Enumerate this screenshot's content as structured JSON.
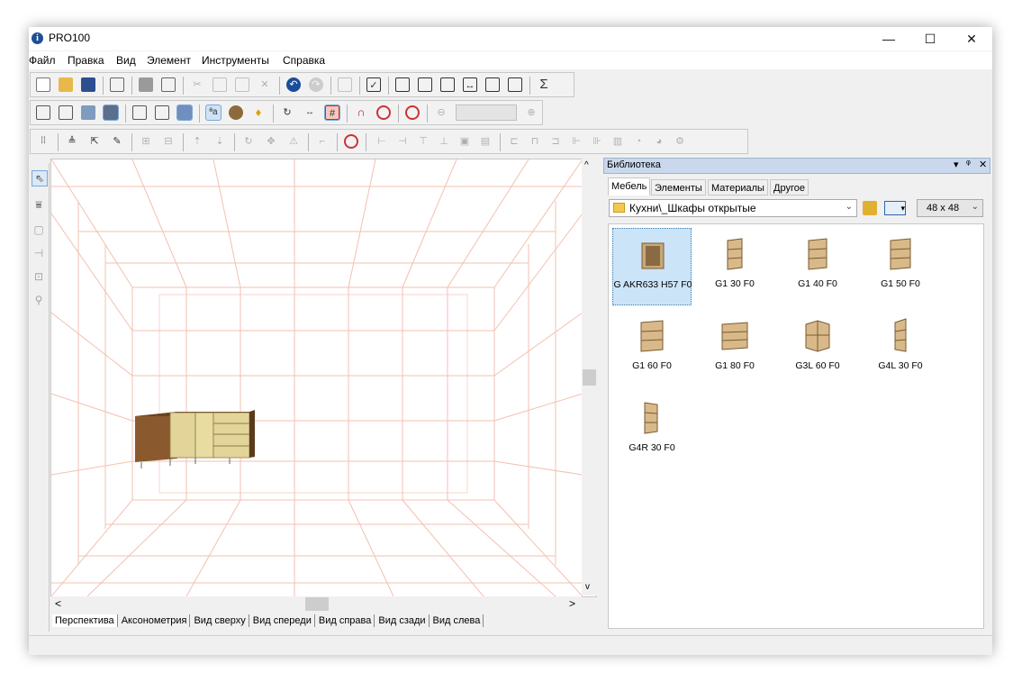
{
  "window": {
    "title": "PRO100",
    "controls": {
      "minimize": "—",
      "maximize": "☐",
      "close": "✕"
    }
  },
  "menu": [
    "Файл",
    "Правка",
    "Вид",
    "Элемент",
    "Инструменты",
    "Справка"
  ],
  "toolbar1": {
    "icons": [
      "new-file-icon",
      "open-icon",
      "save-icon",
      "separator",
      "properties-icon",
      "separator",
      "print-icon",
      "print-preview-icon",
      "separator",
      "cut-icon",
      "copy-icon",
      "paste-icon",
      "delete-icon",
      "separator",
      "undo-icon",
      "redo-icon",
      "separator",
      "clipboard-icon",
      "separator",
      "checklist-icon",
      "separator",
      "report-icon",
      "zoom-page-icon",
      "zoom-fit-icon",
      "width-icon",
      "presentation-icon",
      "money-icon",
      "separator",
      "sum-icon"
    ],
    "sum_glyph": "Σ"
  },
  "toolbar2": {
    "icons": [
      "wireframe-view-icon",
      "outline-view-icon",
      "solid-view-icon",
      "shaded-view-icon",
      "separator",
      "box-outline-icon",
      "box-outline-2-icon",
      "box-solid-icon",
      "separator",
      "text-aa-icon",
      "materials-icon",
      "light-bulb-icon",
      "separator",
      "rotate-icon",
      "dimension-icon",
      "grid-icon",
      "separator",
      "magnet-icon",
      "target-icon",
      "separator",
      "center-icon",
      "separator",
      "zoom-out-icon",
      "zoom-combo",
      "zoom-in-icon"
    ],
    "text_glyph": "ªa"
  },
  "toolbar3": {
    "icons": [
      "snap-grid-icon",
      "separator",
      "level-icon",
      "pointer-3d-icon",
      "pencil-icon",
      "separator",
      "group-icon",
      "ungroup-icon",
      "separator",
      "move-up-icon",
      "move-down-icon",
      "separator",
      "rotate-cw-icon",
      "move-cross-icon",
      "mirror-icon",
      "separator",
      "corner-icon",
      "separator",
      "target-red-icon",
      "separator",
      "align-left-icon",
      "align-right-icon",
      "align-top-icon",
      "align-bottom-icon",
      "align-front-icon",
      "align-back-icon",
      "separator",
      "distribute-left-icon",
      "distribute-center-icon",
      "distribute-right-icon",
      "distribute-h-icon",
      "distribute-v-icon",
      "chart-icon",
      "speech-icon",
      "mass-icon",
      "gear-icon"
    ]
  },
  "left_tools": [
    "pointer-tool-icon",
    "wall-tool-icon",
    "box-tool-icon",
    "dimension-tool-icon",
    "note-tool-icon",
    "zoom-tool-icon"
  ],
  "view_tabs": [
    "Перспектива",
    "Аксонометрия",
    "Вид сверху",
    "Вид спереди",
    "Вид справа",
    "Вид сзади",
    "Вид слева"
  ],
  "active_view_tab": "Перспектива",
  "scroll": {
    "left": "<",
    "right": ">",
    "up": "^",
    "down": "v"
  },
  "library": {
    "title": "Библиотека",
    "header_controls": [
      "▾",
      "ᵠ",
      "✕"
    ],
    "tabs": [
      "Мебель",
      "Элементы",
      "Материалы",
      "Другое"
    ],
    "active_tab": "Мебель",
    "path": "Кухни\\_Шкафы открытые",
    "icon_size": "48 x 48",
    "items": [
      {
        "label": "G AKR633 H57 F0",
        "selected": true
      },
      {
        "label": "G1 30 F0",
        "selected": false
      },
      {
        "label": "G1 40 F0",
        "selected": false
      },
      {
        "label": "G1 50 F0",
        "selected": false
      },
      {
        "label": "G1 60 F0",
        "selected": false
      },
      {
        "label": "G1 80 F0",
        "selected": false
      },
      {
        "label": "G3L 60 F0",
        "selected": false
      },
      {
        "label": "G4L 30 F0",
        "selected": false
      },
      {
        "label": "G4R 30 F0",
        "selected": false
      }
    ]
  },
  "colors": {
    "grid_lines": "#f0b8a8",
    "selection": "#cce4f7",
    "cabinet_wood": "#c9a878",
    "kitchen_brown": "#8a5a2e",
    "kitchen_cream": "#e8dca0"
  }
}
